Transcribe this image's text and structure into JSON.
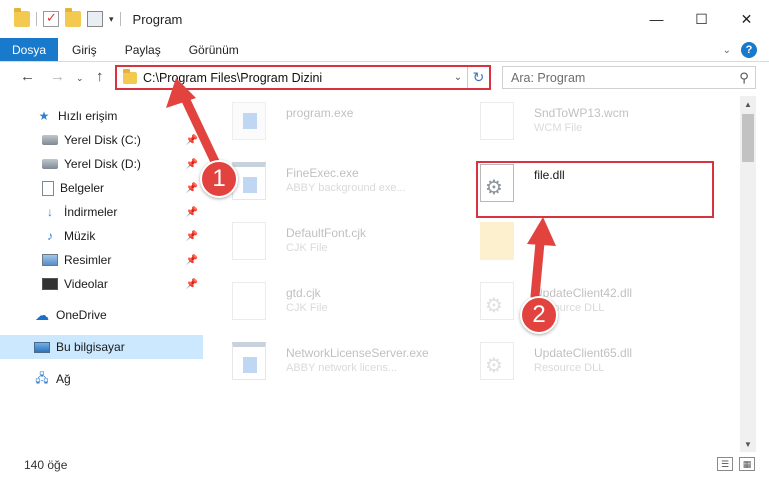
{
  "window": {
    "title": "Program",
    "minimize": "—",
    "maximize": "☐",
    "close": "✕"
  },
  "ribbon": {
    "tabs": [
      "Dosya",
      "Giriş",
      "Paylaş",
      "Görünüm"
    ],
    "help": "?"
  },
  "address": {
    "path": "C:\\Program Files\\Program Dizini"
  },
  "search": {
    "placeholder": "Ara: Program"
  },
  "sidebar": {
    "items": [
      {
        "label": "Hızlı erişim",
        "icon": "star-icon"
      },
      {
        "label": "Yerel Disk (C:)",
        "icon": "disk-icon"
      },
      {
        "label": "Yerel Disk (D:)",
        "icon": "disk-icon"
      },
      {
        "label": "Belgeler",
        "icon": "document-icon"
      },
      {
        "label": "İndirmeler",
        "icon": "download-icon"
      },
      {
        "label": "Müzik",
        "icon": "music-icon"
      },
      {
        "label": "Resimler",
        "icon": "pictures-icon"
      },
      {
        "label": "Videolar",
        "icon": "videos-icon"
      },
      {
        "label": "OneDrive",
        "icon": "cloud-icon"
      },
      {
        "label": "Bu bilgisayar",
        "icon": "computer-icon"
      },
      {
        "label": "Ağ",
        "icon": "network-icon"
      }
    ]
  },
  "files": [
    {
      "name": "program.exe",
      "desc": "",
      "icon": "exe-icon"
    },
    {
      "name": "SndToWP13.wcm",
      "desc": "WCM File",
      "icon": "file-icon"
    },
    {
      "name": "FineExec.exe",
      "desc": "ABBY background exe...",
      "icon": "app-icon"
    },
    {
      "name": "file.dll",
      "desc": "",
      "icon": "dll-icon"
    },
    {
      "name": "DefaultFont.cjk",
      "desc": "CJK File",
      "icon": "file-icon"
    },
    {
      "name": "",
      "desc": "",
      "icon": "folder-icon"
    },
    {
      "name": "gtd.cjk",
      "desc": "CJK File",
      "icon": "file-icon"
    },
    {
      "name": "UpdateClient42.dll",
      "desc": "Resource DLL",
      "icon": "dll-icon"
    },
    {
      "name": "NetworkLicenseServer.exe",
      "desc": "ABBY network licens...",
      "icon": "app-icon"
    },
    {
      "name": "UpdateClient65.dll",
      "desc": "Resource DLL",
      "icon": "dll-icon"
    }
  ],
  "status": {
    "count": "140 öğe"
  },
  "steps": [
    "1",
    "2"
  ],
  "colors": {
    "accent": "#1979ca",
    "highlight": "#d9333f",
    "badge": "#e2433f",
    "selection": "#cce8ff"
  }
}
